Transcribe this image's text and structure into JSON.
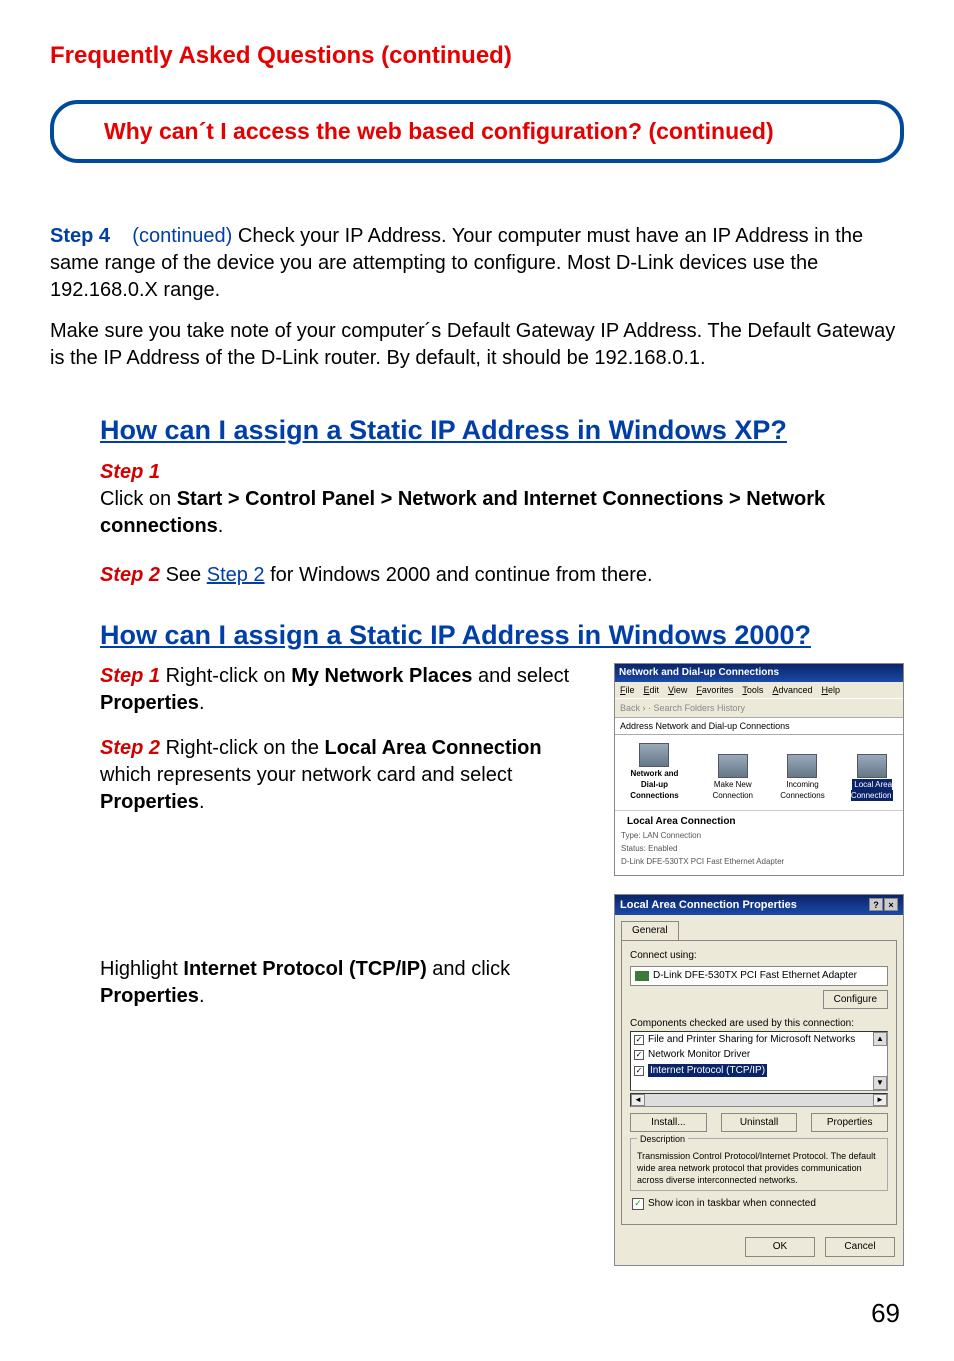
{
  "page_title": "Frequently Asked Questions (continued)",
  "faq_box": "Why can´t I access the web based configuration? (continued)",
  "body": {
    "step4_label": "Step 4",
    "step4_continued": "(continued)",
    "step4_text": "Check your IP Address. Your computer must have an IP Address in the same range of the device you are attempting to configure. Most D-Link devices use the 192.168.0.X range.",
    "gateway_note": "Make sure you take note of your computer´s Default Gateway IP Address. The Default Gateway is the IP Address of the D-Link router. By default, it should be 192.168.0.1."
  },
  "xp": {
    "heading": "How can I assign a Static IP Address in Windows XP?",
    "step1_label": "Step 1",
    "step1_a": "Click on ",
    "step1_b": "Start > Control Panel > Network and Internet Connections > Network connections",
    "step1_c": ".",
    "step2_label": "Step 2",
    "step2_a": " See ",
    "step2_link": "Step 2",
    "step2_b": " for Windows 2000 and continue from there."
  },
  "w2k": {
    "heading": "How can I assign a Static IP Address in Windows 2000?",
    "step1_label": "Step 1",
    "step1_a": " Right-click on ",
    "step1_b": "My Network Places",
    "step1_c": " and select ",
    "step1_d": "Properties",
    "step1_e": ".",
    "step2_label": "Step 2",
    "step2_a": " Right-click on the ",
    "step2_b": "Local Area Connection",
    "step2_c": " which represents your network card and select ",
    "step2_d": "Properties",
    "step2_e": ".",
    "hl_a": "Highlight ",
    "hl_b": "Internet Protocol (TCP/IP)",
    "hl_c": " and click ",
    "hl_d": "Properties",
    "hl_e": "."
  },
  "shot1": {
    "title": "Network and Dial-up Connections",
    "menu": [
      "File",
      "Edit",
      "View",
      "Favorites",
      "Tools",
      "Advanced",
      "Help"
    ],
    "toolbar": "Back  ›  ·  Search  Folders  History",
    "address_label": "Address",
    "address_value": "Network and Dial-up Connections",
    "icons": [
      {
        "label": "Network and Dial-up Connections",
        "big": true
      },
      {
        "label": "Make New Connection"
      },
      {
        "label": "Incoming Connections"
      },
      {
        "label": "Local Area Connection",
        "selected": true
      }
    ],
    "info_title": "Local Area Connection",
    "info_lines": [
      "Type: LAN Connection",
      "Status: Enabled",
      "D-Link DFE-530TX PCI Fast Ethernet Adapter"
    ]
  },
  "shot2": {
    "title": "Local Area Connection Properties",
    "tab": "General",
    "connect_using": "Connect using:",
    "adapter": "D-Link DFE-530TX PCI Fast Ethernet Adapter",
    "configure": "Configure",
    "components_label": "Components checked are used by this connection:",
    "components": [
      "File and Printer Sharing for Microsoft Networks",
      "Network Monitor Driver",
      "Internet Protocol (TCP/IP)"
    ],
    "install": "Install...",
    "uninstall": "Uninstall",
    "properties": "Properties",
    "description_label": "Description",
    "description_text": "Transmission Control Protocol/Internet Protocol. The default wide area network protocol that provides communication across diverse interconnected networks.",
    "show_icon": "Show icon in taskbar when connected",
    "ok": "OK",
    "cancel": "Cancel"
  },
  "page_number": "69"
}
